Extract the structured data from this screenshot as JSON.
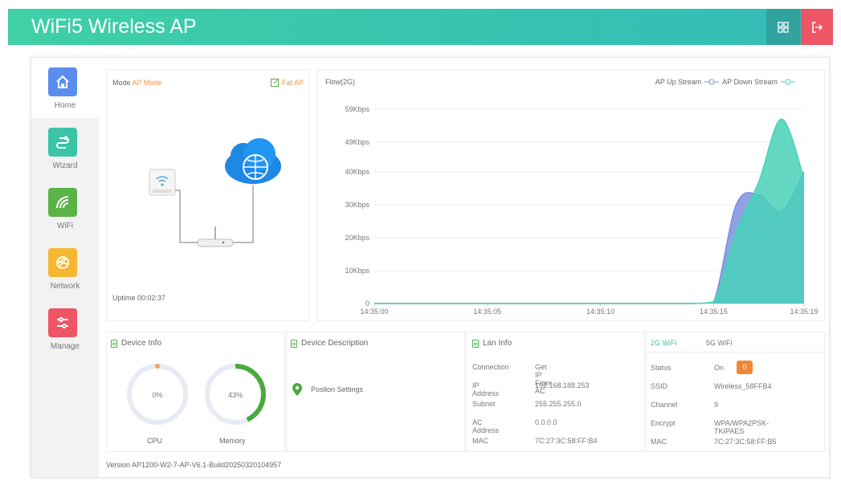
{
  "header": {
    "title": "WiFi5 Wireless AP",
    "grid_icon": "grid-icon",
    "logout_icon": "logout-icon"
  },
  "sidebar": {
    "items": [
      {
        "label": "Home",
        "icon": "home-icon",
        "color": "#5b8def",
        "active": true
      },
      {
        "label": "Wizard",
        "icon": "wizard-icon",
        "color": "#3cc4a9",
        "active": false
      },
      {
        "label": "WiFi",
        "icon": "wifi-icon",
        "color": "#5bb247",
        "active": false
      },
      {
        "label": "Network",
        "icon": "network-icon",
        "color": "#f5b731",
        "active": false
      },
      {
        "label": "Manage",
        "icon": "manage-icon",
        "color": "#ee5565",
        "active": false
      }
    ]
  },
  "mode_card": {
    "mode_label": "Mode",
    "mode_value": "AP Mode",
    "fat_ap": "Fat AP",
    "uptime_label": "Uptime",
    "uptime_value": "00:02:37"
  },
  "flow_chart": {
    "title": "Flow(2G)",
    "legend_up": "AP Up Stream",
    "legend_down": "AP Down Stream"
  },
  "chart_data": {
    "type": "area",
    "title": "Flow(2G)",
    "x": [
      "14:35:00",
      "14:35:01",
      "14:35:02",
      "14:35:03",
      "14:35:04",
      "14:35:05",
      "14:35:06",
      "14:35:07",
      "14:35:08",
      "14:35:09",
      "14:35:10",
      "14:35:11",
      "14:35:12",
      "14:35:13",
      "14:35:14",
      "14:35:15",
      "14:35:16",
      "14:35:17",
      "14:35:18",
      "14:35:19"
    ],
    "x_ticks": [
      "14:35:00",
      "14:35:05",
      "14:35:10",
      "14:35:15",
      "14:35:19"
    ],
    "y_ticks": [
      "0",
      "10Kbps",
      "20Kbps",
      "30Kbps",
      "40Kbps",
      "49Kbps",
      "59Kbps"
    ],
    "y_tick_values": [
      0,
      10,
      20,
      30,
      40,
      49,
      59
    ],
    "ylim": [
      0,
      59
    ],
    "unit": "Kbps",
    "series": [
      {
        "name": "AP Up Stream",
        "color": "#7b8fe0",
        "values": [
          0,
          0,
          0,
          0,
          0,
          0,
          0,
          0,
          0,
          0,
          0,
          0,
          0,
          0,
          0,
          0.5,
          30,
          33,
          28,
          40
        ]
      },
      {
        "name": "AP Down Stream",
        "color": "#49d1b9",
        "values": [
          0,
          0,
          0,
          0,
          0,
          0,
          0,
          0,
          0,
          0,
          0,
          0,
          0,
          0,
          0,
          0.5,
          22,
          37,
          56,
          38
        ]
      }
    ],
    "grid": true,
    "legend": "top-right"
  },
  "device_info": {
    "title": "Device Info",
    "cpu": {
      "label": "CPU",
      "value": 0,
      "text": "0%"
    },
    "memory": {
      "label": "Memory",
      "value": 43,
      "text": "43%"
    }
  },
  "device_description": {
    "title": "Device Description",
    "position_label": "Positon Settings"
  },
  "lan_info": {
    "title": "Lan Info",
    "rows": [
      {
        "k": "Connection",
        "v": "Get IP From AC"
      },
      {
        "k": "IP Address",
        "v": "192.168.188.253"
      },
      {
        "k": "Subnet",
        "v": "255.255.255.0"
      },
      {
        "k": "AC Address",
        "v": "0.0.0.0"
      },
      {
        "k": "MAC",
        "v": "7C:27:3C:58:FF:B4"
      }
    ]
  },
  "wifi_info": {
    "tabs": [
      "2G WiFi",
      "5G WiFi"
    ],
    "status_label": "Status",
    "status_value": "On",
    "status_badge": "0",
    "rows": [
      {
        "k": "SSID",
        "v": "Wireless_58FFB4"
      },
      {
        "k": "Channel",
        "v": "9"
      },
      {
        "k": "Encrypt",
        "v": "WPA/WPA2PSK-TKIPAES"
      },
      {
        "k": "MAC",
        "v": "7C:27:3C:58:FF:B5"
      }
    ]
  },
  "footer": {
    "version_label": "Version",
    "version_value": "AP1200-W2-7-AP-V6.1-Build20250320104957"
  }
}
